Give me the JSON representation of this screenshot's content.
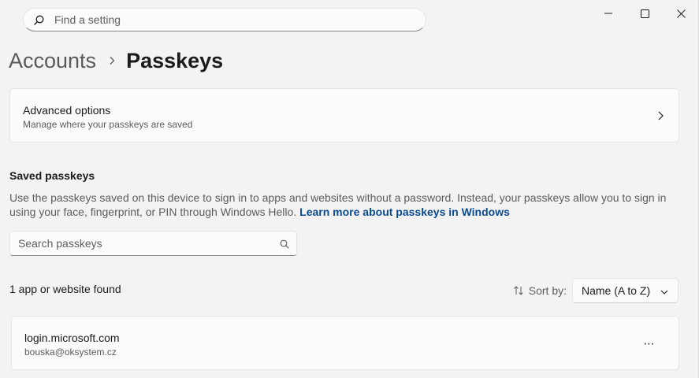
{
  "search": {
    "placeholder": "Find a setting"
  },
  "breadcrumb": {
    "parent": "Accounts",
    "current": "Passkeys"
  },
  "advanced": {
    "title": "Advanced options",
    "subtitle": "Manage where your passkeys are saved"
  },
  "saved": {
    "title": "Saved passkeys",
    "description": "Use the passkeys saved on this device to sign in to apps and websites without a password. Instead, your passkeys allow you to sign in using your face, fingerprint, or PIN through Windows Hello.",
    "link": "Learn more about passkeys in Windows",
    "search_placeholder": "Search passkeys",
    "count": "1 app or website found",
    "sort_label": "Sort by:",
    "sort_value": "Name (A to Z)"
  },
  "entries": [
    {
      "site": "login.microsoft.com",
      "user": "bouska@oksystem.cz",
      "more": "⋯"
    }
  ],
  "icons": {
    "search": "search-icon",
    "minimize": "minimize-icon",
    "maximize": "maximize-icon",
    "close": "close-icon",
    "chevron": "chevron-right-icon",
    "sort": "sort-icon",
    "dropdown": "chevron-down-icon"
  },
  "colors": {
    "link": "#0a4a8f",
    "background": "#f3f3f3",
    "card": "#fbfbfb"
  }
}
